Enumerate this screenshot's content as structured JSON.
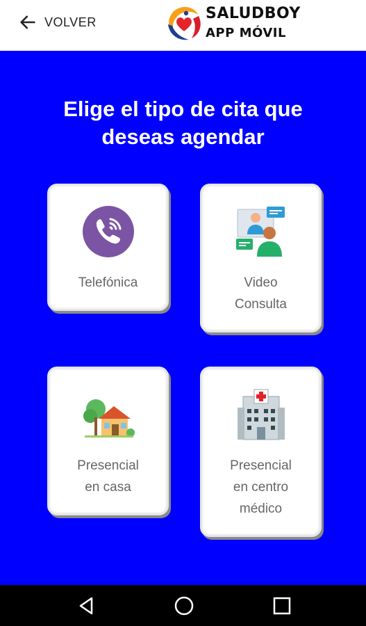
{
  "header": {
    "back_label": "VOLVER",
    "brand_title": "SALUDBOY",
    "brand_subtitle": "APP MÓVIL"
  },
  "main": {
    "heading": "Elige el tipo de cita que deseas agendar",
    "background_color": "#0000ff"
  },
  "options": [
    {
      "label": "Telefónica",
      "icon": "phone-call-icon"
    },
    {
      "label": "Video\nConsulta",
      "icon": "video-call-icon"
    },
    {
      "label": "Presencial\nen casa",
      "icon": "house-icon"
    },
    {
      "label": "Presencial\nen centro\nmédico",
      "icon": "hospital-icon"
    }
  ],
  "navbar": {
    "buttons": [
      "back-triangle-icon",
      "home-circle-icon",
      "recents-square-icon"
    ]
  }
}
